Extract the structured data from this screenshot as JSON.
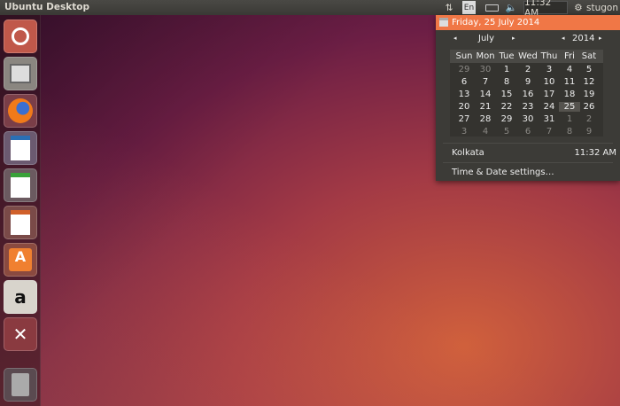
{
  "topbar": {
    "title": "Ubuntu Desktop",
    "keyboard": "En",
    "clock": "11:32 AM",
    "user": "stugon"
  },
  "launcher": {
    "items": [
      "Dash",
      "Files",
      "Firefox",
      "LibreOffice Writer",
      "LibreOffice Calc",
      "LibreOffice Impress",
      "Ubuntu Software Center",
      "Amazon",
      "System Settings",
      "Trash"
    ]
  },
  "calendar_menu": {
    "date": "Friday, 25 July 2014",
    "month": "July",
    "year": "2014",
    "weekdays": [
      "Sun",
      "Mon",
      "Tue",
      "Wed",
      "Thu",
      "Fri",
      "Sat"
    ],
    "weeks": [
      [
        "29",
        "30",
        "1",
        "2",
        "3",
        "4",
        "5"
      ],
      [
        "6",
        "7",
        "8",
        "9",
        "10",
        "11",
        "12"
      ],
      [
        "13",
        "14",
        "15",
        "16",
        "17",
        "18",
        "19"
      ],
      [
        "20",
        "21",
        "22",
        "23",
        "24",
        "25",
        "26"
      ],
      [
        "27",
        "28",
        "29",
        "30",
        "31",
        "1",
        "2"
      ],
      [
        "3",
        "4",
        "5",
        "6",
        "7",
        "8",
        "9"
      ]
    ],
    "location": "Kolkata",
    "location_time": "11:32 AM",
    "settings": "Time & Date settings…"
  }
}
